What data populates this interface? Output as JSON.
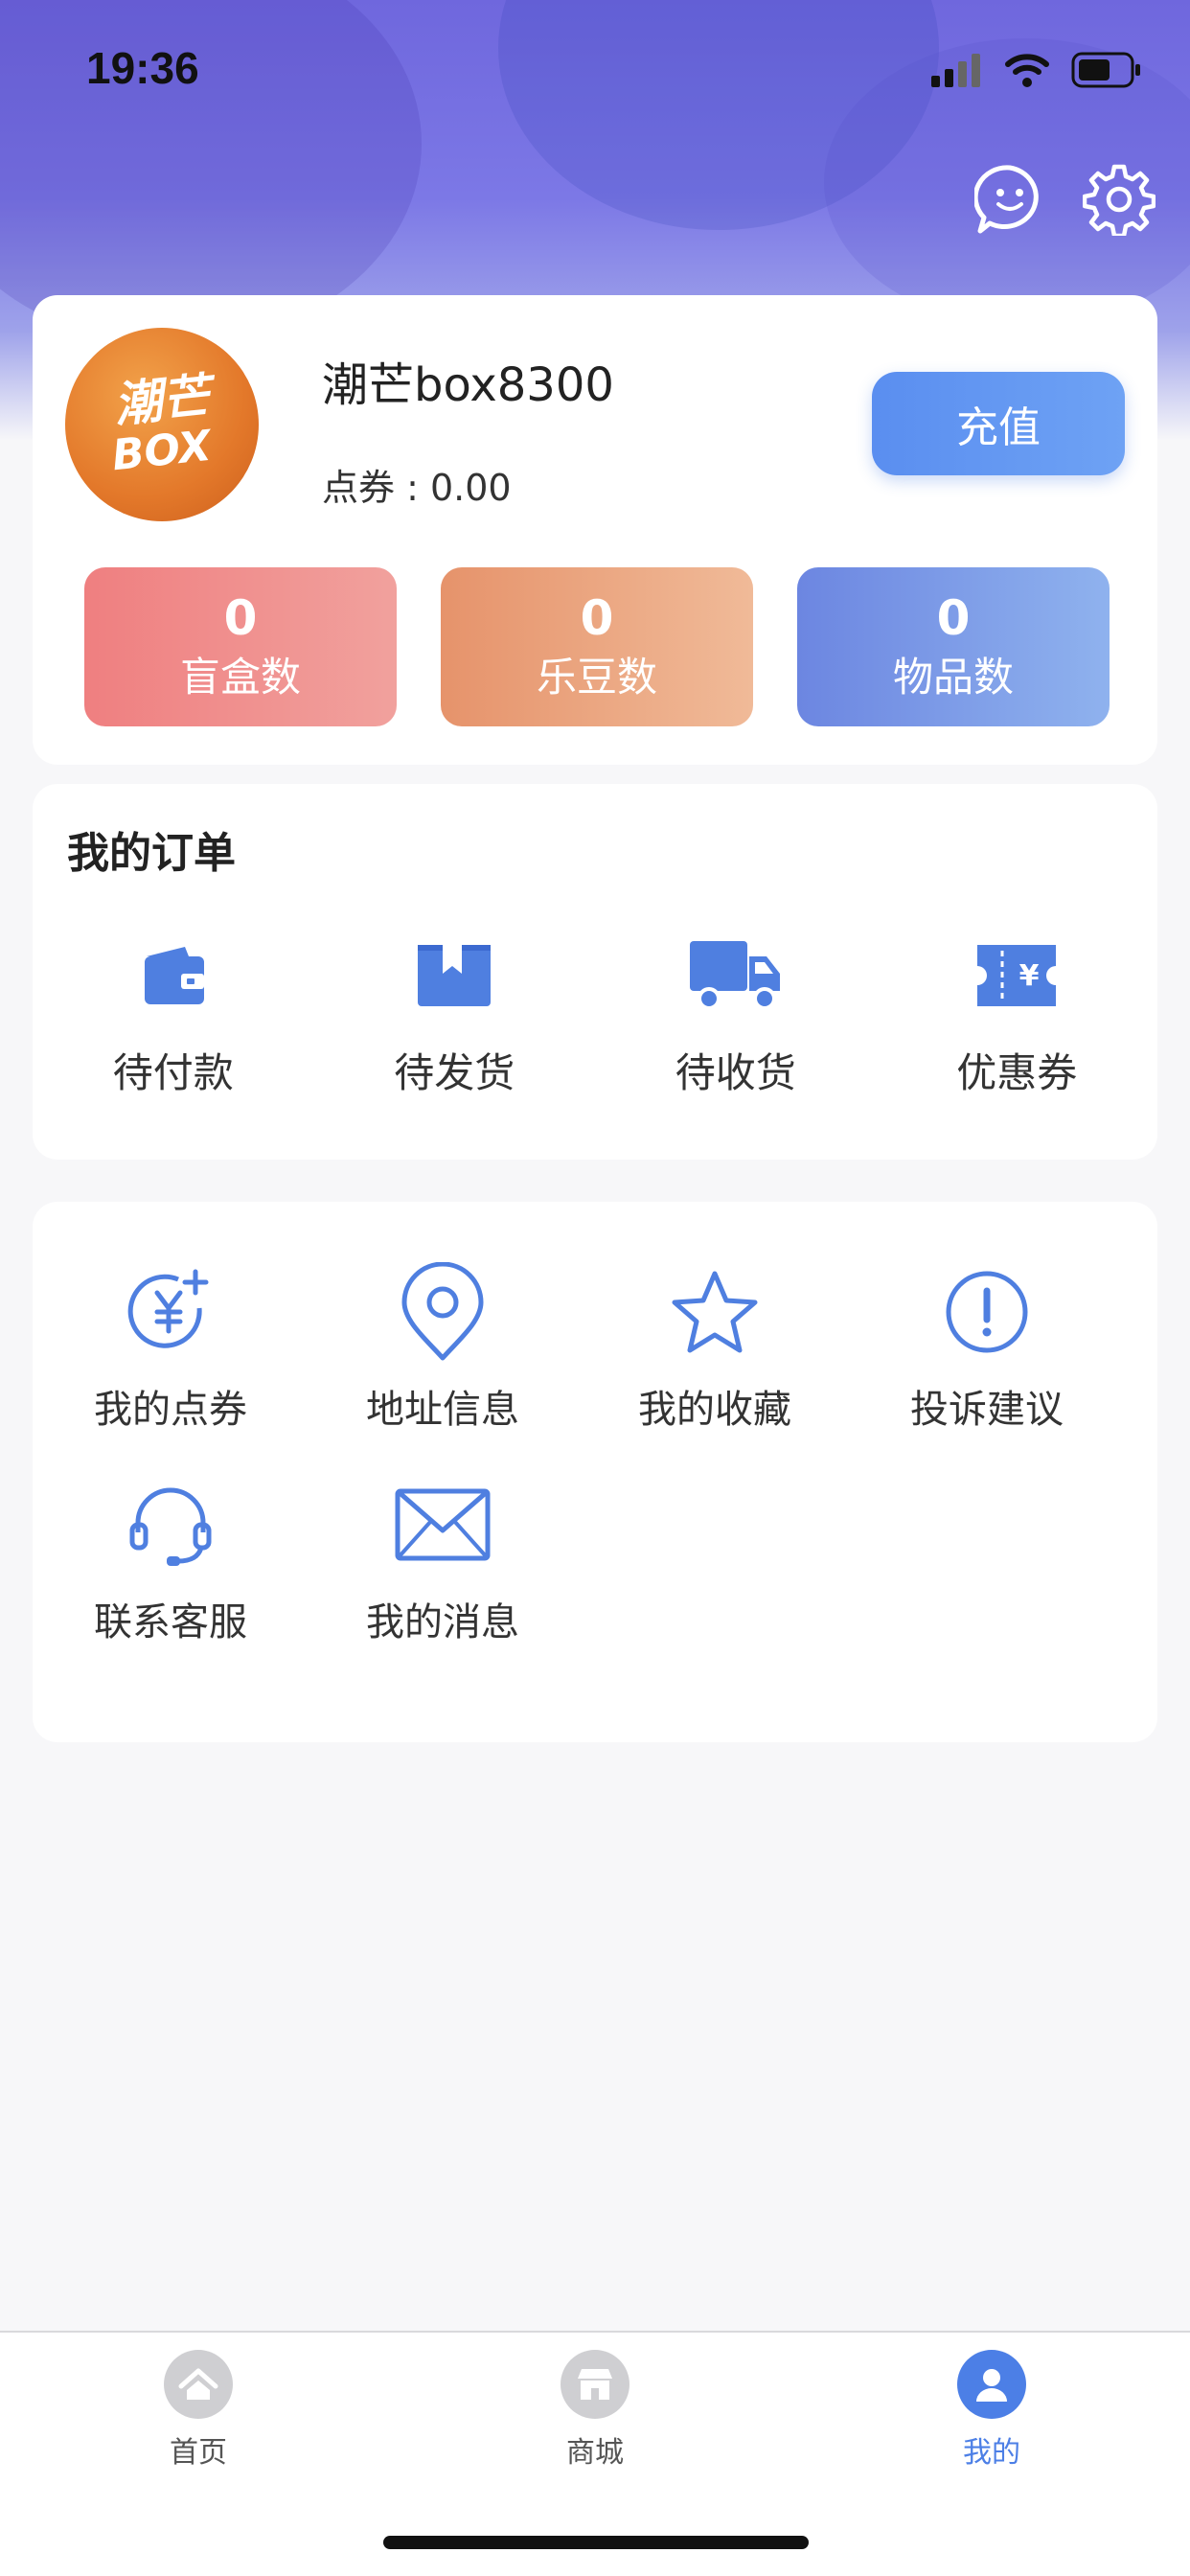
{
  "status_bar": {
    "time": "19:36"
  },
  "profile": {
    "avatar_text_line1": "潮芒",
    "avatar_text_line2": "BOX",
    "username": "潮芒box8300",
    "points_label": "点券 : 0.00",
    "recharge_label": "充值",
    "stats": [
      {
        "value": "0",
        "label": "盲盒数"
      },
      {
        "value": "0",
        "label": "乐豆数"
      },
      {
        "value": "0",
        "label": "物品数"
      }
    ]
  },
  "orders": {
    "title": "我的订单",
    "items": [
      {
        "label": "待付款",
        "icon": "wallet-icon"
      },
      {
        "label": "待发货",
        "icon": "box-icon"
      },
      {
        "label": "待收货",
        "icon": "truck-icon"
      },
      {
        "label": "优惠券",
        "icon": "coupon-icon"
      }
    ]
  },
  "services": {
    "items": [
      {
        "label": "我的点券",
        "icon": "yen-plus-icon"
      },
      {
        "label": "地址信息",
        "icon": "location-pin-icon"
      },
      {
        "label": "我的收藏",
        "icon": "star-icon"
      },
      {
        "label": "投诉建议",
        "icon": "exclamation-icon"
      },
      {
        "label": "联系客服",
        "icon": "headset-icon"
      },
      {
        "label": "我的消息",
        "icon": "envelope-icon"
      }
    ]
  },
  "tabbar": {
    "items": [
      {
        "label": "首页",
        "icon": "home-icon",
        "active": false
      },
      {
        "label": "商城",
        "icon": "store-icon",
        "active": false
      },
      {
        "label": "我的",
        "icon": "user-icon",
        "active": true
      }
    ]
  },
  "colors": {
    "accent": "#4c7fe6",
    "icon": "#4f7fe0"
  }
}
